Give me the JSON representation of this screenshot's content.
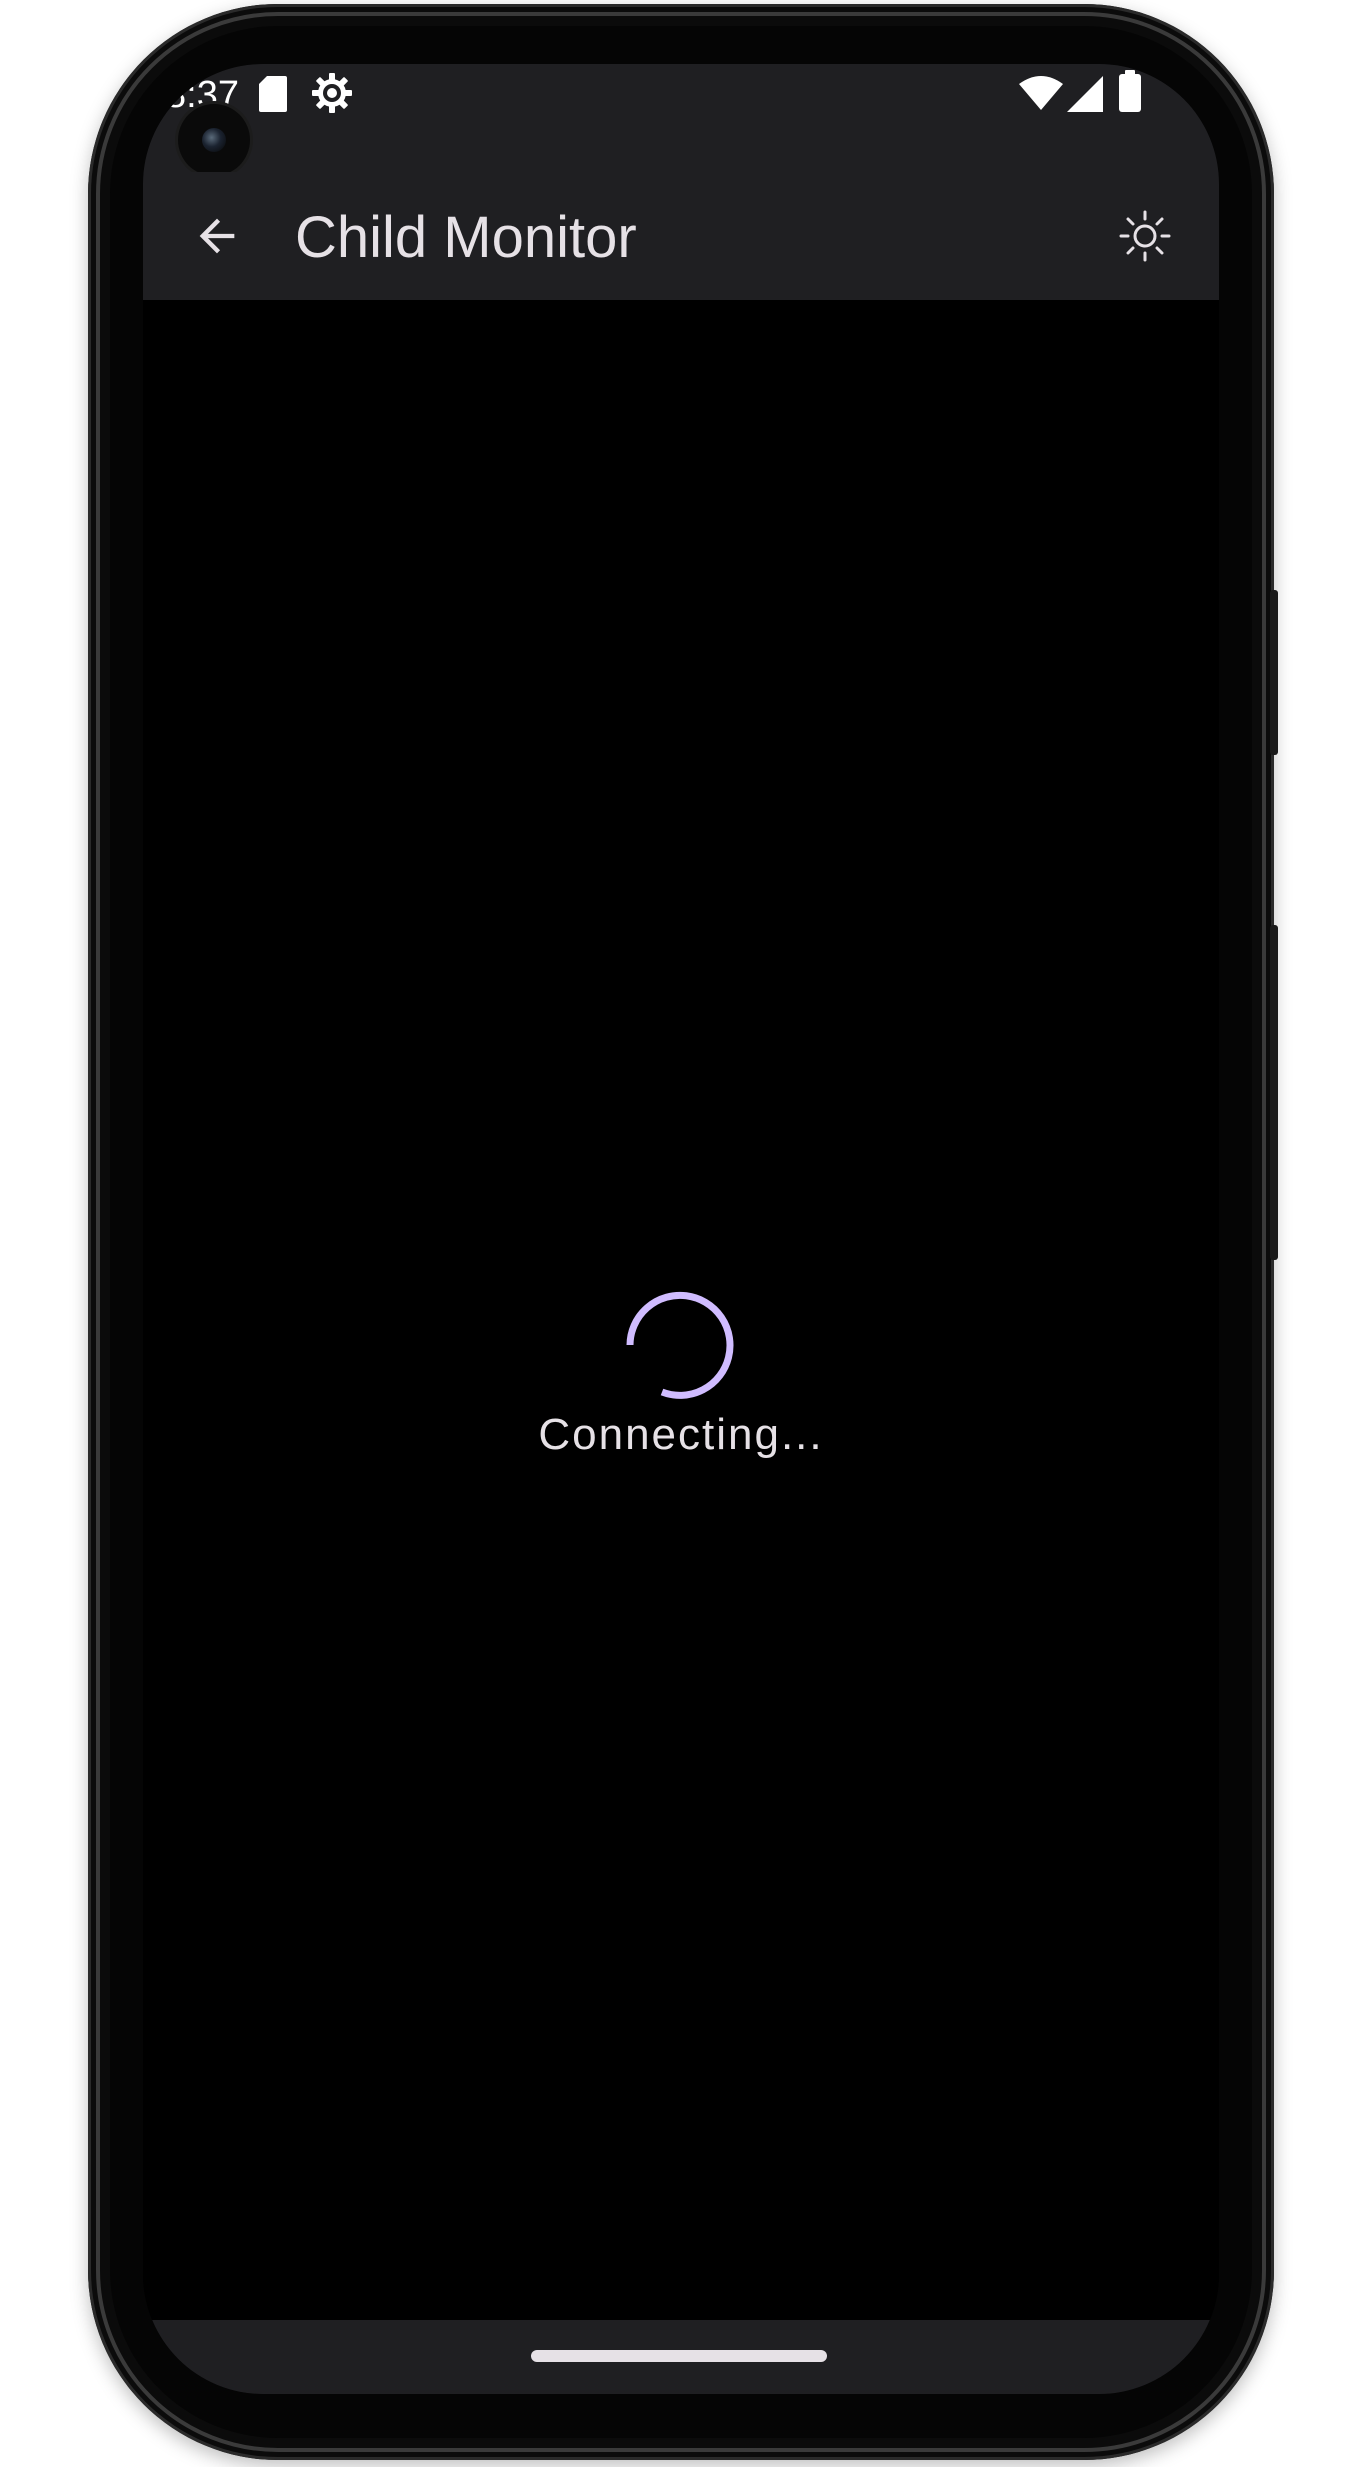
{
  "status_bar": {
    "time": "8:37",
    "icons": [
      "sd-card-icon",
      "settings-gear-icon",
      "wifi-icon",
      "cell-signal-icon",
      "battery-icon"
    ]
  },
  "app_bar": {
    "title": "Child Monitor",
    "back_icon": "arrow-back-icon",
    "action_icon": "brightness-icon"
  },
  "content": {
    "status_text": "Connecting..."
  },
  "colors": {
    "surface": "#1f1f22",
    "background": "#000000",
    "on_surface": "#e6e1e6",
    "accent": "#d0bcff"
  }
}
